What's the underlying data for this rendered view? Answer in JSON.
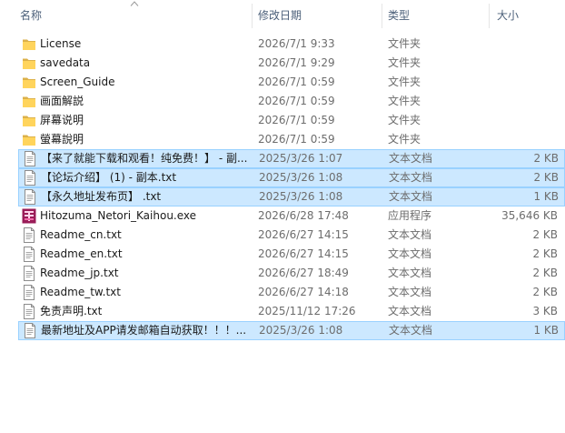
{
  "columns": {
    "name": "名称",
    "date": "修改日期",
    "type": "类型",
    "size": "大小"
  },
  "files": [
    {
      "name": "License",
      "date": "2026/7/1 9:33",
      "type": "文件夹",
      "size": "",
      "icon": "folder-icon",
      "selected": false
    },
    {
      "name": "savedata",
      "date": "2026/7/1 9:29",
      "type": "文件夹",
      "size": "",
      "icon": "folder-icon",
      "selected": false
    },
    {
      "name": "Screen_Guide",
      "date": "2026/7/1 0:59",
      "type": "文件夹",
      "size": "",
      "icon": "folder-icon",
      "selected": false
    },
    {
      "name": "画面解説",
      "date": "2026/7/1 0:59",
      "type": "文件夹",
      "size": "",
      "icon": "folder-icon",
      "selected": false
    },
    {
      "name": "屏幕说明",
      "date": "2026/7/1 0:59",
      "type": "文件夹",
      "size": "",
      "icon": "folder-icon",
      "selected": false
    },
    {
      "name": "螢幕說明",
      "date": "2026/7/1 0:59",
      "type": "文件夹",
      "size": "",
      "icon": "folder-icon",
      "selected": false
    },
    {
      "name": "【来了就能下载和观看！纯免费！】 - 副...",
      "date": "2025/3/26 1:07",
      "type": "文本文档",
      "size": "2 KB",
      "icon": "text-file-icon",
      "selected": true
    },
    {
      "name": "【论坛介绍】 (1) - 副本.txt",
      "date": "2025/3/26 1:08",
      "type": "文本文档",
      "size": "2 KB",
      "icon": "text-file-icon",
      "selected": true
    },
    {
      "name": "【永久地址发布页】 .txt",
      "date": "2025/3/26 1:08",
      "type": "文本文档",
      "size": "1 KB",
      "icon": "text-file-icon",
      "selected": true
    },
    {
      "name": "Hitozuma_Netori_Kaihou.exe",
      "date": "2026/6/28 17:48",
      "type": "应用程序",
      "size": "35,646 KB",
      "icon": "app-icon",
      "selected": false
    },
    {
      "name": "Readme_cn.txt",
      "date": "2026/6/27 14:15",
      "type": "文本文档",
      "size": "2 KB",
      "icon": "text-file-icon",
      "selected": false
    },
    {
      "name": "Readme_en.txt",
      "date": "2026/6/27 14:15",
      "type": "文本文档",
      "size": "2 KB",
      "icon": "text-file-icon",
      "selected": false
    },
    {
      "name": "Readme_jp.txt",
      "date": "2026/6/27 18:49",
      "type": "文本文档",
      "size": "2 KB",
      "icon": "text-file-icon",
      "selected": false
    },
    {
      "name": "Readme_tw.txt",
      "date": "2026/6/27 14:18",
      "type": "文本文档",
      "size": "2 KB",
      "icon": "text-file-icon",
      "selected": false
    },
    {
      "name": "免责声明.txt",
      "date": "2025/11/12 17:26",
      "type": "文本文档",
      "size": "3 KB",
      "icon": "text-file-icon",
      "selected": false
    },
    {
      "name": "最新地址及APP请发邮箱自动获取！！！...",
      "date": "2025/3/26 1:08",
      "type": "文本文档",
      "size": "1 KB",
      "icon": "text-file-icon",
      "selected": true
    }
  ]
}
